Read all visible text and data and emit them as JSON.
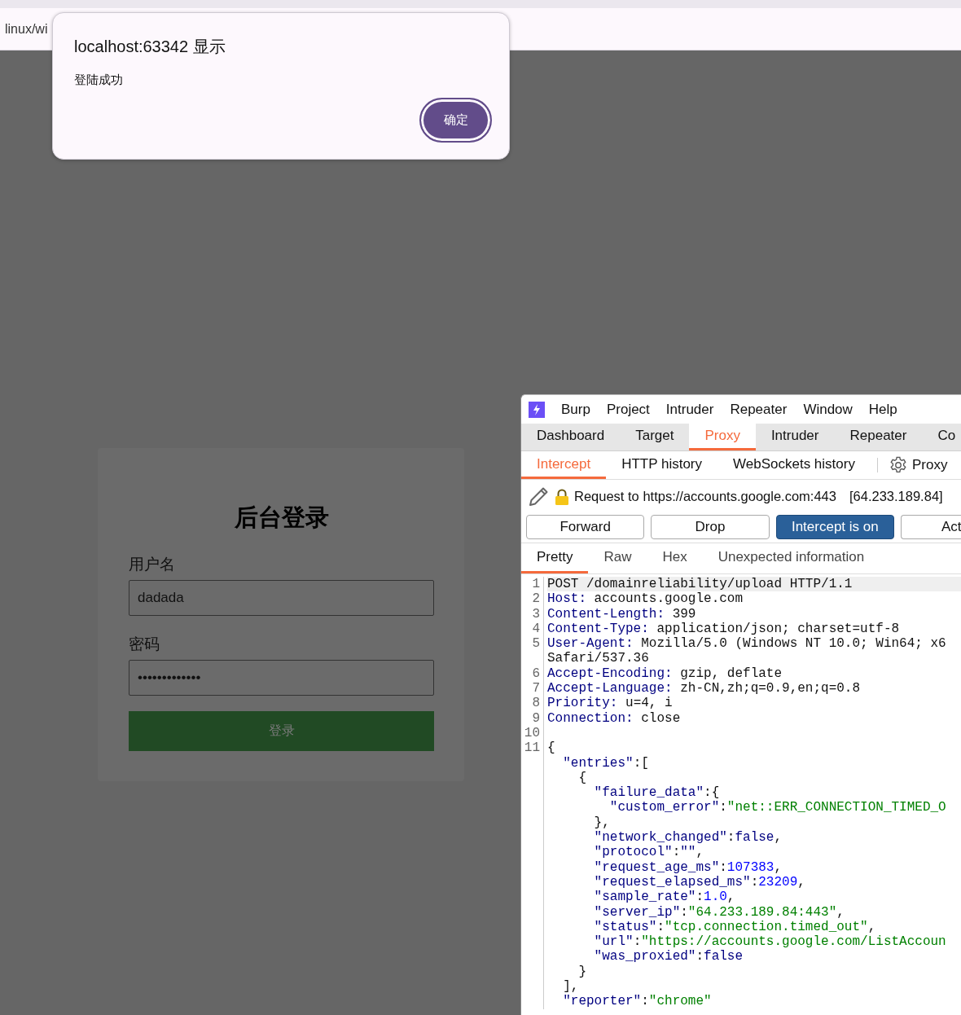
{
  "browser": {
    "address": "linux/wi"
  },
  "dialog": {
    "title": "localhost:63342 显示",
    "message": "登陆成功",
    "button": "确定"
  },
  "login": {
    "title": "后台登录",
    "fields": [
      {
        "label": "用户名",
        "value": "dadada"
      },
      {
        "label": "密码",
        "value": "•••••••••••••"
      }
    ],
    "button": "登录"
  },
  "burp": {
    "menu": [
      "Burp",
      "Project",
      "Intruder",
      "Repeater",
      "Window",
      "Help"
    ],
    "tabs": [
      {
        "label": "Dashboard",
        "selected": false
      },
      {
        "label": "Target",
        "selected": false
      },
      {
        "label": "Proxy",
        "selected": true
      },
      {
        "label": "Intruder",
        "selected": false
      },
      {
        "label": "Repeater",
        "selected": false
      },
      {
        "label": "Co",
        "selected": false
      }
    ],
    "subtabs": [
      {
        "label": "Intercept",
        "selected": true
      },
      {
        "label": "HTTP history",
        "selected": false
      },
      {
        "label": "WebSockets history",
        "selected": false
      }
    ],
    "settings": "Proxy",
    "request": {
      "text": "Request to https://accounts.google.com:443",
      "ip": "[64.233.189.84]"
    },
    "actions": [
      {
        "kind": "button",
        "label": "Forward"
      },
      {
        "kind": "button",
        "label": "Drop"
      },
      {
        "kind": "toggle",
        "label": "Intercept is on",
        "on": true
      },
      {
        "kind": "button",
        "label": "Act"
      }
    ],
    "editor_tabs": [
      {
        "label": "Pretty",
        "selected": true
      },
      {
        "label": "Raw",
        "selected": false
      },
      {
        "label": "Hex",
        "selected": false
      },
      {
        "label": "Unexpected information",
        "selected": false
      }
    ],
    "lines": [
      {
        "number": "1",
        "segments": [
          {
            "kind": "plain",
            "text": "POST /domainreliability/upload HTTP/1.1"
          }
        ]
      },
      {
        "number": "2",
        "segments": [
          {
            "kind": "name",
            "text": "Host:"
          },
          {
            "kind": "plain",
            "text": " accounts.google.com"
          }
        ]
      },
      {
        "number": "3",
        "segments": [
          {
            "kind": "name",
            "text": "Content-Length:"
          },
          {
            "kind": "plain",
            "text": " 399"
          }
        ]
      },
      {
        "number": "4",
        "segments": [
          {
            "kind": "name",
            "text": "Content-Type:"
          },
          {
            "kind": "plain",
            "text": " application/json; charset=utf-8"
          }
        ]
      },
      {
        "number": "5",
        "segments": [
          {
            "kind": "name",
            "text": "User-Agent:"
          },
          {
            "kind": "plain",
            "text": " Mozilla/5.0 (Windows NT 10.0; Win64; x6"
          }
        ]
      },
      {
        "segments": [
          {
            "kind": "plain",
            "text": "Safari/537.36"
          }
        ]
      },
      {
        "number": "6",
        "segments": [
          {
            "kind": "name",
            "text": "Accept-Encoding:"
          },
          {
            "kind": "plain",
            "text": " gzip, deflate"
          }
        ]
      },
      {
        "number": "7",
        "segments": [
          {
            "kind": "name",
            "text": "Accept-Language:"
          },
          {
            "kind": "plain",
            "text": " zh-CN,zh;q=0.9,en;q=0.8"
          }
        ]
      },
      {
        "number": "8",
        "segments": [
          {
            "kind": "name",
            "text": "Priority:"
          },
          {
            "kind": "plain",
            "text": " u=4, i"
          }
        ]
      },
      {
        "number": "9",
        "segments": [
          {
            "kind": "name",
            "text": "Connection:"
          },
          {
            "kind": "plain",
            "text": " close"
          }
        ]
      },
      {
        "number": "10"
      },
      {
        "number": "11",
        "segments": [
          {
            "kind": "plain",
            "text": "{"
          }
        ]
      },
      {
        "segments": [
          {
            "kind": "key",
            "text": "  \"entries\""
          },
          {
            "kind": "plain",
            "text": ":["
          }
        ]
      },
      {
        "segments": [
          {
            "kind": "plain",
            "text": "    {"
          }
        ]
      },
      {
        "segments": [
          {
            "kind": "key",
            "text": "      \"failure_data\""
          },
          {
            "kind": "plain",
            "text": ":{"
          }
        ]
      },
      {
        "segments": [
          {
            "kind": "key",
            "text": "        \"custom_error\""
          },
          {
            "kind": "plain",
            "text": ":"
          },
          {
            "kind": "string",
            "text": "\"net::ERR_CONNECTION_TIMED_O"
          }
        ]
      },
      {
        "segments": [
          {
            "kind": "plain",
            "text": "      },"
          }
        ]
      },
      {
        "segments": [
          {
            "kind": "key",
            "text": "      \"network_changed\""
          },
          {
            "kind": "plain",
            "text": ":"
          },
          {
            "kind": "key",
            "text": "false"
          },
          {
            "kind": "plain",
            "text": ","
          }
        ]
      },
      {
        "segments": [
          {
            "kind": "key",
            "text": "      \"protocol\""
          },
          {
            "kind": "plain",
            "text": ":"
          },
          {
            "kind": "key",
            "text": "\"\""
          },
          {
            "kind": "plain",
            "text": ","
          }
        ]
      },
      {
        "segments": [
          {
            "kind": "key",
            "text": "      \"request_age_ms\""
          },
          {
            "kind": "plain",
            "text": ":"
          },
          {
            "kind": "number",
            "text": "107383"
          },
          {
            "kind": "plain",
            "text": ","
          }
        ]
      },
      {
        "segments": [
          {
            "kind": "key",
            "text": "      \"request_elapsed_ms\""
          },
          {
            "kind": "plain",
            "text": ":"
          },
          {
            "kind": "number",
            "text": "23209"
          },
          {
            "kind": "plain",
            "text": ","
          }
        ]
      },
      {
        "segments": [
          {
            "kind": "key",
            "text": "      \"sample_rate\""
          },
          {
            "kind": "plain",
            "text": ":"
          },
          {
            "kind": "number",
            "text": "1.0"
          },
          {
            "kind": "plain",
            "text": ","
          }
        ]
      },
      {
        "segments": [
          {
            "kind": "key",
            "text": "      \"server_ip\""
          },
          {
            "kind": "plain",
            "text": ":"
          },
          {
            "kind": "string",
            "text": "\"64.233.189.84:443\""
          },
          {
            "kind": "plain",
            "text": ","
          }
        ]
      },
      {
        "segments": [
          {
            "kind": "key",
            "text": "      \"status\""
          },
          {
            "kind": "plain",
            "text": ":"
          },
          {
            "kind": "string",
            "text": "\"tcp.connection.timed_out\""
          },
          {
            "kind": "plain",
            "text": ","
          }
        ]
      },
      {
        "segments": [
          {
            "kind": "key",
            "text": "      \"url\""
          },
          {
            "kind": "plain",
            "text": ":"
          },
          {
            "kind": "string",
            "text": "\"https://accounts.google.com/ListAccoun"
          }
        ]
      },
      {
        "segments": [
          {
            "kind": "key",
            "text": "      \"was_proxied\""
          },
          {
            "kind": "plain",
            "text": ":"
          },
          {
            "kind": "key",
            "text": "false"
          }
        ]
      },
      {
        "segments": [
          {
            "kind": "plain",
            "text": "    }"
          }
        ]
      },
      {
        "segments": [
          {
            "kind": "plain",
            "text": "  ],"
          }
        ]
      },
      {
        "segments": [
          {
            "kind": "key",
            "text": "  \"reporter\""
          },
          {
            "kind": "plain",
            "text": ":"
          },
          {
            "kind": "string",
            "text": "\"chrome\""
          }
        ]
      }
    ]
  }
}
